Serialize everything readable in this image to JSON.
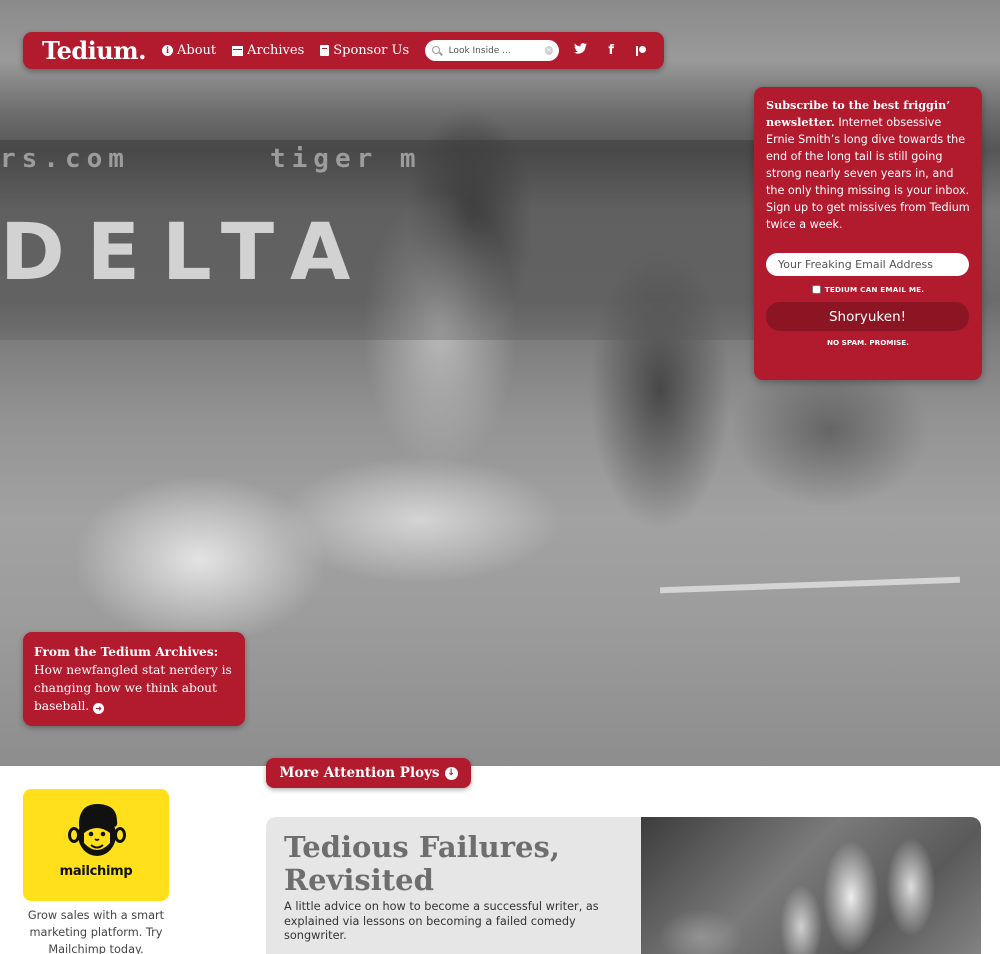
{
  "nav": {
    "logo": "Tedium.",
    "links": [
      {
        "label": "About",
        "icon": "info-icon"
      },
      {
        "label": "Archives",
        "icon": "archive-icon"
      },
      {
        "label": "Sponsor Us",
        "icon": "book-icon"
      }
    ],
    "search_placeholder": "Look Inside ...",
    "social": [
      "twitter-icon",
      "facebook-icon",
      "patreon-icon"
    ]
  },
  "hero": {
    "wall_text": "DELTA",
    "wall_url_left": "rs.com",
    "wall_url_right": "tiger   m"
  },
  "newsletter": {
    "heading": "Subscribe to the best friggin’ newsletter.",
    "body": " Internet obsessive Ernie Smith’s long dive towards the end of the long tail is still going strong nearly seven years in, and the only thing missing is your inbox. Sign up to get missives from Tedium twice a week.",
    "email_placeholder": "Your Freaking Email Address",
    "consent_label": "TEDIUM CAN EMAIL ME.",
    "submit_label": "Shoryuken!",
    "footnote": "NO SPAM. PROMISE."
  },
  "archive_callout": {
    "heading": "From the Tedium Archives:",
    "body": "How newfangled stat nerdery is changing how we think about baseball."
  },
  "ploys_button": "More Attention Ploys",
  "ad": {
    "brand": "mailchimp",
    "copy": "Grow sales with a smart marketing platform. Try Mailchimp today."
  },
  "feature": {
    "title": "Tedious Failures, Revisited",
    "dek": "A little advice on how to become a successful writer, as explained via lessons on becoming a failed comedy songwriter."
  },
  "colors": {
    "brand_red": "#b21a2e",
    "button_dark_red": "#8c1524",
    "ad_yellow": "#ffe01b"
  }
}
